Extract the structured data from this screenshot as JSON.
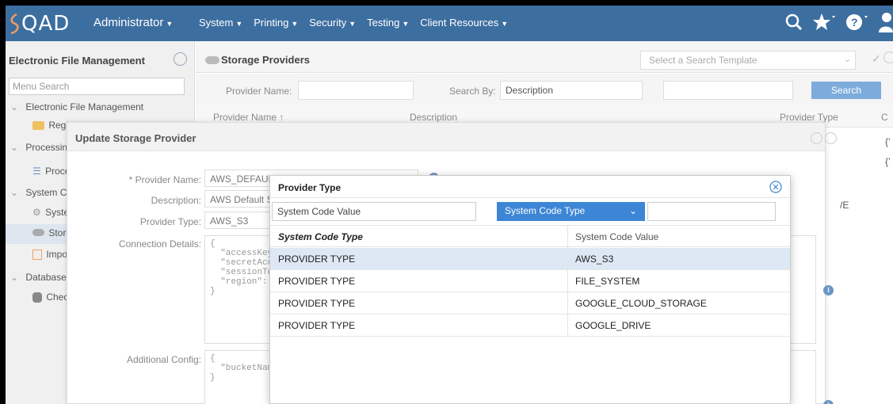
{
  "header": {
    "logo_text": "QAD",
    "role": "Administrator",
    "nav": [
      "System",
      "Printing",
      "Security",
      "Testing",
      "Client Resources"
    ],
    "colors": {
      "bar": "#3d6ea0",
      "logo_accent": "#f29b61"
    }
  },
  "left_panel": {
    "title": "Electronic File Management",
    "search_placeholder": "Menu Search",
    "items": [
      {
        "label": "Electronic File Management",
        "icon": "chevron-down-icon"
      },
      {
        "label": "Registry",
        "icon": "folder-icon"
      },
      {
        "label": "Processing",
        "icon": "chevron-down-icon"
      },
      {
        "label": "Processing",
        "icon": "list-icon"
      },
      {
        "label": "System Configuration",
        "icon": "chevron-down-icon"
      },
      {
        "label": "System",
        "icon": "wrench-icon"
      },
      {
        "label": "Storage Providers",
        "icon": "cloud-icon"
      },
      {
        "label": "Import",
        "icon": "import-icon"
      },
      {
        "label": "Database",
        "icon": "chevron-down-icon"
      },
      {
        "label": "Check",
        "icon": "database-icon"
      }
    ]
  },
  "main": {
    "title": "Storage Providers",
    "template_placeholder": "Select a Search Template",
    "search": {
      "provider_name_label": "Provider Name:",
      "search_by_label": "Search By:",
      "search_by_value": "Description",
      "button": "Search"
    },
    "grid_headers": [
      "Provider Name ↑",
      "Description",
      "Provider Type",
      "C"
    ],
    "peek": [
      "{’",
      "{’",
      "/E"
    ]
  },
  "update_dialog": {
    "title": "Update Storage Provider",
    "provider_name_label": "* Provider Name:",
    "provider_name_value": "AWS_DEFAULT_CLOUD_STORAGE",
    "description_label": "Description:",
    "description_value": "AWS Default Storage",
    "provider_type_label": "Provider Type:",
    "provider_type_value": "AWS_S3",
    "connection_label": "Connection Details:",
    "connection_value": "{\n  \"accessKeyId\"\n  \"secretAccess\n  \"sessionToken\n  \"region\": \"\"\n}",
    "additional_label": "Additional Config:",
    "additional_value": "{\n  \"bucketName\"\n}"
  },
  "provider_type_dialog": {
    "title": "Provider Type",
    "filter_value_placeholder": "System Code Value",
    "filter_type_value": "System Code Type",
    "headers": [
      "System Code Type",
      "System Code Value"
    ],
    "rows": [
      {
        "type": "PROVIDER TYPE",
        "value": "AWS_S3"
      },
      {
        "type": "PROVIDER TYPE",
        "value": "FILE_SYSTEM"
      },
      {
        "type": "PROVIDER TYPE",
        "value": "GOOGLE_CLOUD_STORAGE"
      },
      {
        "type": "PROVIDER TYPE",
        "value": "GOOGLE_DRIVE"
      }
    ]
  }
}
